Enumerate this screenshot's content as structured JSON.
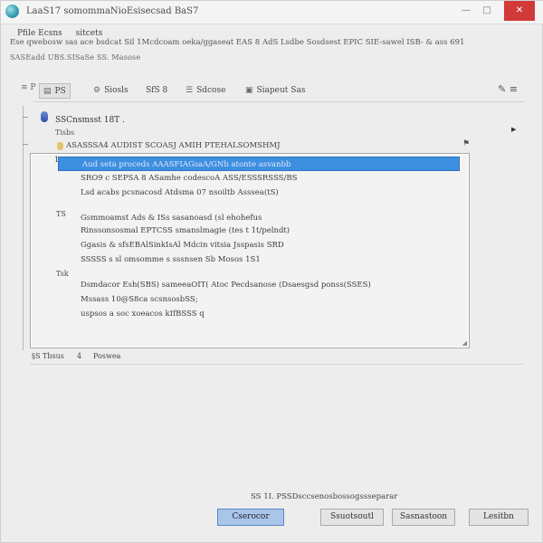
{
  "window": {
    "title": "LaaS17 somommaNioEsisecsad BaS7",
    "min_glyph": "—",
    "max_glyph": "□",
    "close_glyph": "✕"
  },
  "menu": {
    "items": [
      "Pfile Ecsns",
      "sitcets"
    ]
  },
  "info_line": "Ese qwebosw sas ace bsdcat Sil 1Mcdcoam oeka/ggaseat EAS 8 AdS Lsdbe Sosdsest EPIC SIE-sawel ISB- & ass 691",
  "section_label": "SASEadd UBS.SISaSe SS. Masose",
  "toolbar": {
    "handle": "≡ P",
    "items": [
      {
        "label": "PS",
        "icon": "▤"
      },
      {
        "label": "Siosls",
        "icon": "⚙"
      },
      {
        "label": "SfS 8",
        "icon": ""
      },
      {
        "label": "Sdcose",
        "icon": "☰"
      },
      {
        "label": "Siapeut Sas",
        "icon": "▣"
      }
    ],
    "right_icon": "✎ ≡"
  },
  "tree": {
    "node_title": "SSCnsmsst 18T .",
    "node_sub": "Tisbs",
    "node_arrow": "▶",
    "header_text": "ASASSSA4 AUDIST SCOASJ AMIH PTEHALSOMSHMJ",
    "header_flag": "⚑"
  },
  "list": {
    "selected_marker": "1",
    "rows": [
      "Aud seta proceds AAASFIAGsaA/GNb atonte asvanbb",
      "SRO9 c SEPSA 8 ASamhe codescoA ASS/ESSSRSSS/BS",
      "Lsd acabs pcsnacosd Atdsma 07 nsoiltb Asssea(tS)",
      "Gsmmoamst Ads & ISs sasanoasd (sl ehohefus",
      "Rinssonsosmal EPTCSS smanslmagie (tes t 1t/pelndt)",
      "Ggasis & sfsEBAlSinkIsAl Mdcin vitsia Jsspasis SRD",
      "SSSSS s sl omsomme s sssnsen Sb Mosos 1S1",
      "Dsmdacor Esh(SBS) sameeaOIT( Atoc Pecdsanose (Dsaesgsd ponss(SSES)",
      "Mssass 10@S8ca scsnsosbSS;",
      "uspsos a soc xoeacos kIfBSSS q"
    ],
    "tags": [
      "TS",
      "Tsk"
    ],
    "resize_glyph": "◢"
  },
  "status": {
    "left": "§S Tbsus",
    "mid": "4",
    "right": "Poswea"
  },
  "footer": {
    "note": "SS 1I. PSSDsccsenosbossogssseparar"
  },
  "buttons": [
    "Cserocor",
    "Ssuotsoutl",
    "Sasnastoon",
    "Lesitbn"
  ]
}
